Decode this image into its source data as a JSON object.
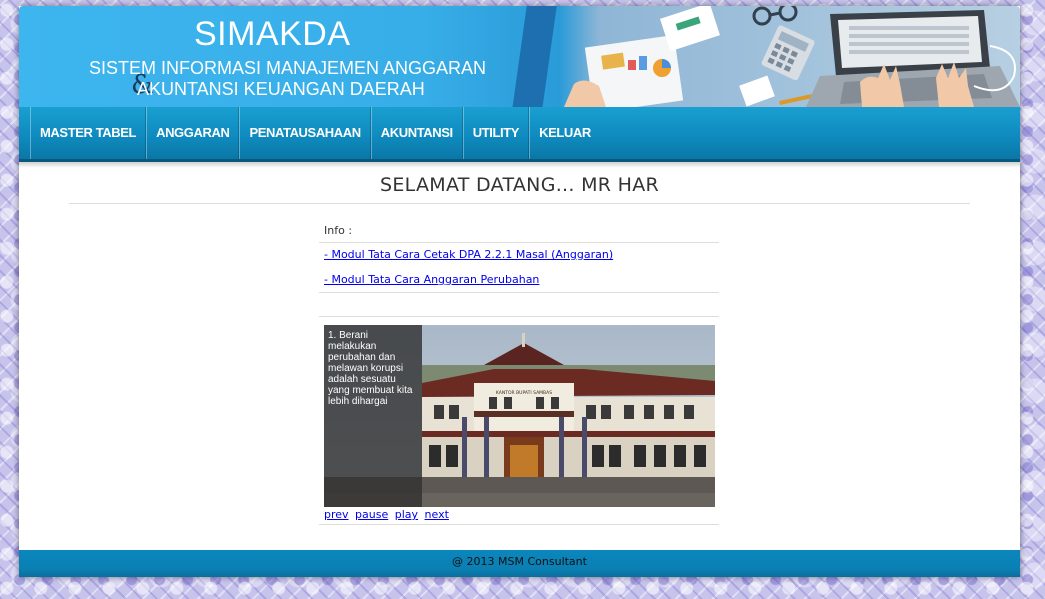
{
  "header": {
    "title": "SIMAKDA",
    "subtitle_line1": "SISTEM INFORMASI MANAJEMEN ANGGARAN",
    "subtitle_line2": "AKUNTANSI KEUANGAN DAERAH",
    "ampersand": "&"
  },
  "nav": {
    "items": [
      {
        "label": "MASTER TABEL"
      },
      {
        "label": "ANGGARAN"
      },
      {
        "label": "PENATAUSAHAAN"
      },
      {
        "label": "AKUNTANSI"
      },
      {
        "label": "UTILITY"
      },
      {
        "label": "KELUAR"
      }
    ]
  },
  "main": {
    "welcome": "SELAMAT DATANG... MR HAR",
    "info_label": "Info :",
    "links": [
      {
        "label": "- Modul Tata Cara Cetak DPA 2.2.1 Masal (Anggaran)"
      },
      {
        "label": "- Modul Tata Cara Anggaran Perubahan"
      }
    ],
    "slideshow": {
      "caption": "1. Berani melakukan perubahan dan melawan korupsi adalah sesuatu yang membuat kita lebih dihargai",
      "building_sign": "KANTOR BUPATI SAMBAS",
      "controls": {
        "prev": "prev",
        "pause": "pause",
        "play": "play",
        "next": "next"
      }
    }
  },
  "footer": {
    "text": "@ 2013 MSM Consultant"
  },
  "colors": {
    "header_blue": "#3db5ee",
    "nav_blue": "#0f8bbf",
    "footer_blue": "#0a7fb3",
    "link": "#0000ee"
  }
}
